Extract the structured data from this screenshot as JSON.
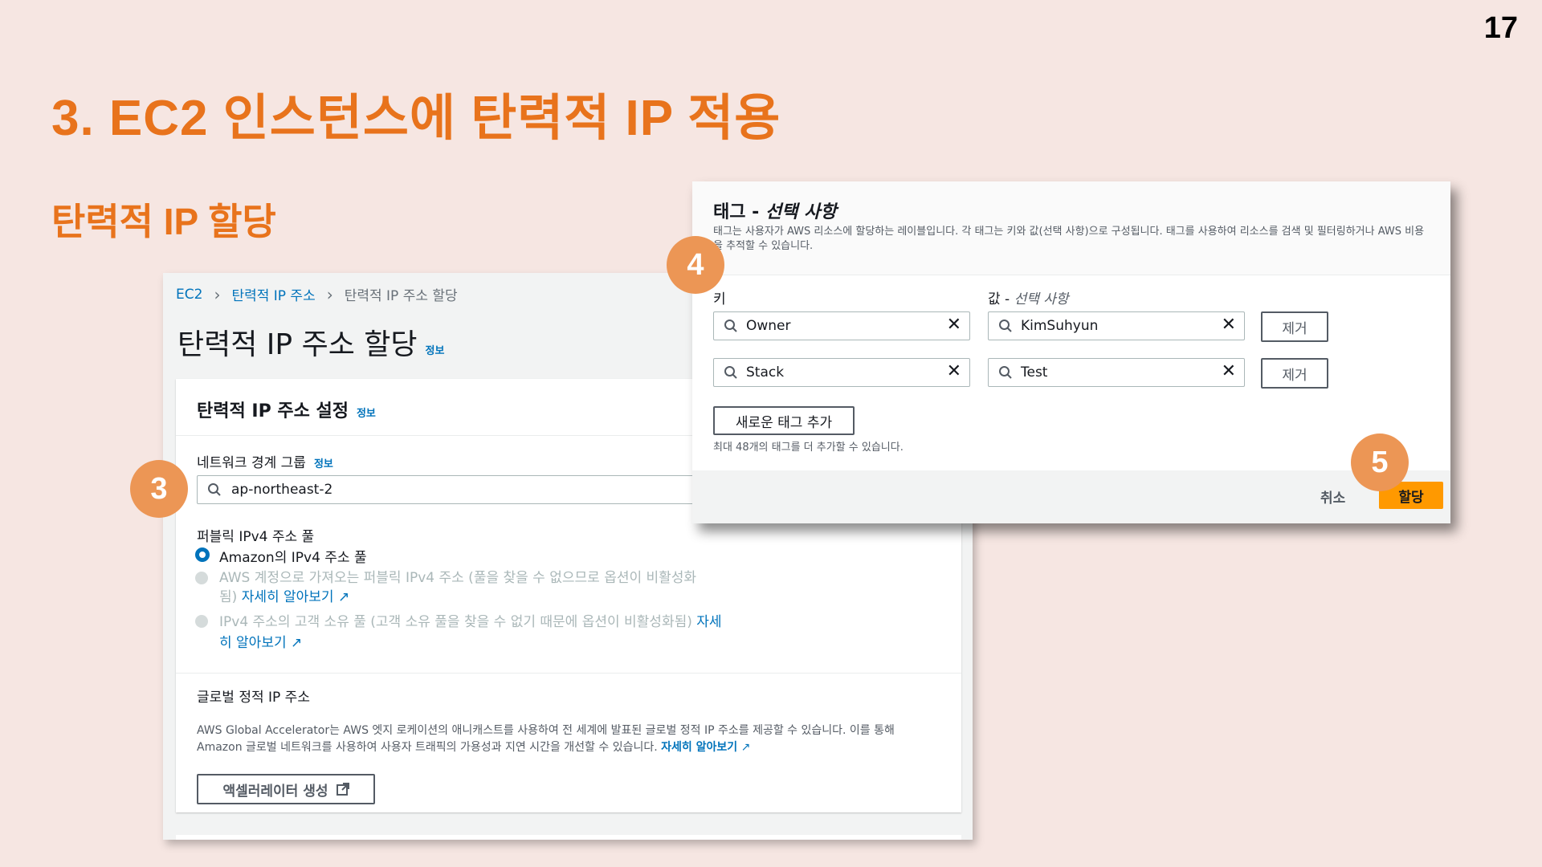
{
  "slide": {
    "page_number": "17",
    "title": "3. EC2 인스턴스에 탄력적 IP 적용",
    "subtitle": "탄력적 IP 할당",
    "accent_color": "#e8731c"
  },
  "console": {
    "breadcrumb": [
      "EC2",
      "탄력적 IP 주소",
      "탄력적 IP 주소 할당"
    ],
    "title": "탄력적 IP 주소 할당",
    "info_label": "정보",
    "settings_card": {
      "title": "탄력적 IP 주소 설정",
      "network_border_group_label": "네트워크 경계 그룹",
      "network_border_group_value": "ap-northeast-2",
      "public_pool_label": "퍼블릭 IPv4 주소 풀",
      "options": [
        {
          "label": "Amazon의 IPv4 주소 풀",
          "selected": true,
          "disabled": false
        },
        {
          "label_line1": "AWS 계정으로 가져오는 퍼블릭 IPv4 주소 (풀을 찾을 수 없으므로 옵션이 비활성화",
          "label_line2": "됨)",
          "link": "자세히 알아보기",
          "selected": false,
          "disabled": true
        },
        {
          "label_line1": "IPv4 주소의 고객 소유 풀 (고객 소유 풀을 찾을 수 없기 때문에 옵션이 비활성화됨)",
          "link_line1": "자세",
          "link_line2": "히 알아보기",
          "selected": false,
          "disabled": true
        }
      ],
      "global_static_label": "글로벌 정적 IP 주소",
      "global_desc": "AWS Global Accelerator는 AWS 엣지 로케이션의 애니캐스트를 사용하여 전 세계에 발표된 글로벌 정적 IP 주소를 제공할 수 있습니다. 이를 통해 Amazon 글로벌 네트워크를 사용하여 사용자 트래픽의 가용성과 지연 시간을 개선할 수 있습니다.",
      "global_desc_link": "자세히 알아보기",
      "create_accelerator_button": "액셀러레이터 생성"
    }
  },
  "tags_dialog": {
    "title_prefix": "태그 - ",
    "title_optional": "선택 사항",
    "description": "태그는 사용자가 AWS 리소스에 할당하는 레이블입니다. 각 태그는 키와 값(선택 사항)으로 구성됩니다. 태그를 사용하여 리소스를 검색 및 필터링하거나 AWS 비용을 추적할 수 있습니다.",
    "key_label": "키",
    "value_label_prefix": "값 - ",
    "value_label_optional": "선택 사항",
    "rows": [
      {
        "key": "Owner",
        "value": "KimSuhyun",
        "remove": "제거"
      },
      {
        "key": "Stack",
        "value": "Test",
        "remove": "제거"
      }
    ],
    "add_tag_button": "새로운 태그 추가",
    "hint": "최대 48개의 태그를 더 추가할 수 있습니다.",
    "cancel_button": "취소",
    "allocate_button": "할당"
  },
  "steps": [
    "3",
    "4",
    "5"
  ],
  "colors": {
    "aws_link": "#0073bb",
    "aws_primary": "#ff9900",
    "step_marker": "#ec9655"
  }
}
